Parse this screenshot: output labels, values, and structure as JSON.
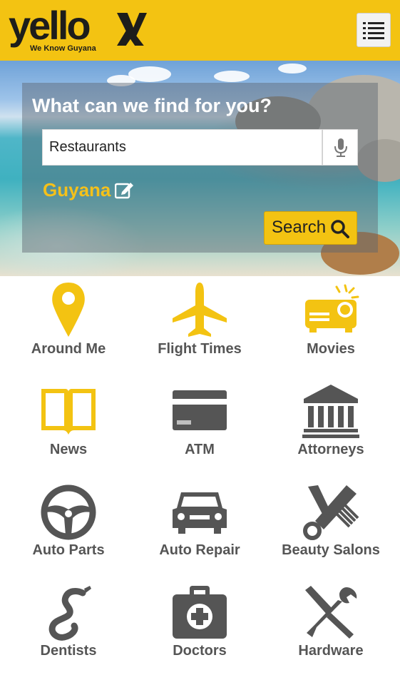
{
  "header": {
    "brand": "yello",
    "tagline": "We Know Guyana",
    "menu_icon": "hamburger-menu-icon"
  },
  "search": {
    "title": "What can we find for you?",
    "query": "Restaurants",
    "mic_icon": "microphone-icon",
    "location": "Guyana",
    "edit_icon": "edit-icon",
    "button_label": "Search",
    "button_icon": "search-icon"
  },
  "categories": [
    {
      "label": "Around Me",
      "icon": "map-pin-icon",
      "color": "#f3c312"
    },
    {
      "label": "Flight Times",
      "icon": "airplane-icon",
      "color": "#f3c312"
    },
    {
      "label": "Movies",
      "icon": "projector-icon",
      "color": "#f3c312"
    },
    {
      "label": "News",
      "icon": "open-book-icon",
      "color": "#f3c312"
    },
    {
      "label": "ATM",
      "icon": "credit-card-icon",
      "color": "#555555"
    },
    {
      "label": "Attorneys",
      "icon": "courthouse-icon",
      "color": "#555555"
    },
    {
      "label": "Auto Parts",
      "icon": "steering-wheel-icon",
      "color": "#555555"
    },
    {
      "label": "Auto Repair",
      "icon": "car-icon",
      "color": "#555555"
    },
    {
      "label": "Beauty Salons",
      "icon": "comb-scissors-icon",
      "color": "#555555"
    },
    {
      "label": "Dentists",
      "icon": "dental-tool-icon",
      "color": "#555555"
    },
    {
      "label": "Doctors",
      "icon": "medical-kit-icon",
      "color": "#555555"
    },
    {
      "label": "Hardware",
      "icon": "wrench-screwdriver-icon",
      "color": "#555555"
    }
  ],
  "colors": {
    "brand_yellow": "#f3c312",
    "icon_gray": "#555555",
    "location_yellow": "#f5c11a"
  }
}
